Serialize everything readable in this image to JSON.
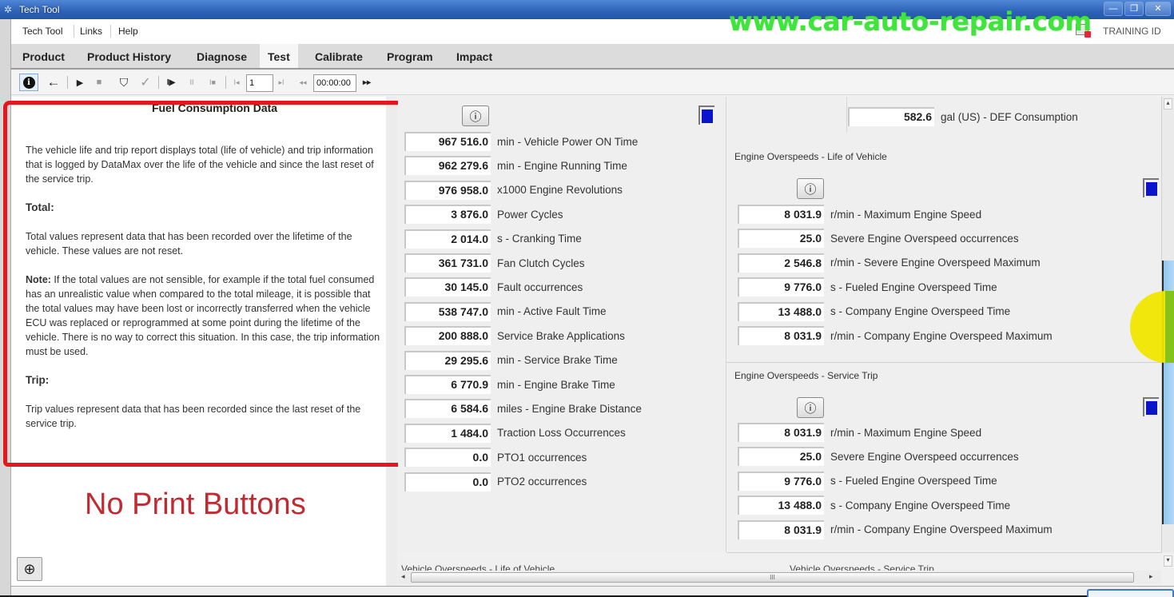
{
  "window": {
    "title": "Tech Tool",
    "controls": {
      "minimize": "—",
      "restore": "❐",
      "close": "✕"
    }
  },
  "menubar": {
    "items": [
      "Tech Tool",
      "Links",
      "Help"
    ],
    "watermark": "www.car-auto-repair.com",
    "training_label": "TRAINING ID"
  },
  "tabs": [
    {
      "label": "Product",
      "active": false
    },
    {
      "label": "Product History",
      "active": false
    },
    {
      "label": "Diagnose",
      "active": false
    },
    {
      "label": "Test",
      "active": true
    },
    {
      "label": "Calibrate",
      "active": false
    },
    {
      "label": "Program",
      "active": false
    },
    {
      "label": "Impact",
      "active": false
    }
  ],
  "toolbar": {
    "icons": {
      "info": "i",
      "back": "←",
      "play": "▶",
      "stop": "■",
      "marker": "⛉",
      "check": "✓",
      "step_play": "I▶",
      "step_pause": "II",
      "step_stop": "I■",
      "first": "I◂",
      "last": "▸I",
      "rewind": "◂◂",
      "forward": "▸▸"
    },
    "page_value": "1",
    "time_value": "00:00:00"
  },
  "help_panel": {
    "title": "Fuel Consumption Data",
    "intro": "The vehicle life and trip report displays total (life of vehicle) and trip information that is logged by DataMax over the life of the vehicle and since the last reset of the service trip.",
    "total_heading": "Total:",
    "total_text": "Total values represent data that has been recorded over the lifetime of the vehicle. These values are not reset.",
    "note_label": "Note:",
    "note_text": " If the total values are not sensible, for example if the total fuel consumed has an unrealistic value when compared to the total mileage, it is possible that the total values may have been lost or incorrectly transferred when the vehicle ECU was replaced or reprogrammed at some point during the lifetime of the vehicle. There is no way to correct this situation. In this case, the trip information must be used.",
    "trip_heading": "Trip:",
    "trip_text": "Trip values represent data that has been recorded since the last reset of the service trip.",
    "annotation": "No Print Buttons",
    "zoom_icon": "⊕"
  },
  "vehicle_life": {
    "graph_icon": "ⓘ",
    "swatch_color": "#0a14c8",
    "rows": [
      {
        "value": "967 516.0",
        "label": "min - Vehicle Power ON Time"
      },
      {
        "value": "962 279.6",
        "label": "min - Engine Running Time"
      },
      {
        "value": "976 958.0",
        "label": "x1000 Engine Revolutions"
      },
      {
        "value": "3 876.0",
        "label": "Power Cycles"
      },
      {
        "value": "2 014.0",
        "label": "s - Cranking Time"
      },
      {
        "value": "361 731.0",
        "label": "Fan Clutch Cycles"
      },
      {
        "value": "30 145.0",
        "label": "Fault occurrences"
      },
      {
        "value": "538 747.0",
        "label": "min - Active Fault Time"
      },
      {
        "value": "200 888.0",
        "label": "Service Brake Applications"
      },
      {
        "value": "29 295.6",
        "label": "min - Service Brake Time"
      },
      {
        "value": "6 770.9",
        "label": "min - Engine Brake Time"
      },
      {
        "value": "6 584.6",
        "label": "miles - Engine Brake Distance"
      },
      {
        "value": "1 484.0",
        "label": "Traction Loss Occurrences"
      },
      {
        "value": "0.0",
        "label": "PTO1 occurrences"
      },
      {
        "value": "0.0",
        "label": "PTO2 occurrences"
      }
    ]
  },
  "def": {
    "value": "582.6",
    "label": "gal (US) - DEF Consumption"
  },
  "overspeed_life": {
    "title": "Engine Overspeeds - Life of Vehicle",
    "rows": [
      {
        "value": "8 031.9",
        "label": "r/min - Maximum Engine Speed"
      },
      {
        "value": "25.0",
        "label": "Severe Engine Overspeed occurrences"
      },
      {
        "value": "2 546.8",
        "label": "r/min - Severe Engine Overspeed Maximum"
      },
      {
        "value": "9 776.0",
        "label": "s - Fueled Engine Overspeed Time"
      },
      {
        "value": "13 488.0",
        "label": "s - Company Engine Overspeed Time"
      },
      {
        "value": "8 031.9",
        "label": "r/min - Company Engine Overspeed Maximum"
      }
    ]
  },
  "overspeed_trip": {
    "title": "Engine Overspeeds - Service Trip",
    "rows": [
      {
        "value": "8 031.9",
        "label": "r/min - Maximum Engine Speed"
      },
      {
        "value": "25.0",
        "label": "Severe Engine Overspeed occurrences"
      },
      {
        "value": "9 776.0",
        "label": "s - Fueled Engine Overspeed Time"
      },
      {
        "value": "13 488.0",
        "label": "s - Company Engine Overspeed Time"
      },
      {
        "value": "8 031.9",
        "label": "r/min - Company Engine Overspeed Maximum"
      }
    ]
  },
  "partial_sections": {
    "vehicle_life": "Vehicle Overspeeds - Life of Vehicle",
    "vehicle_trip": "Vehicle Overspeeds - Service Trip"
  },
  "scrollbars": {
    "h_grip": "III",
    "left": "◂",
    "right": "▸",
    "up": "▴",
    "down": "▾"
  }
}
